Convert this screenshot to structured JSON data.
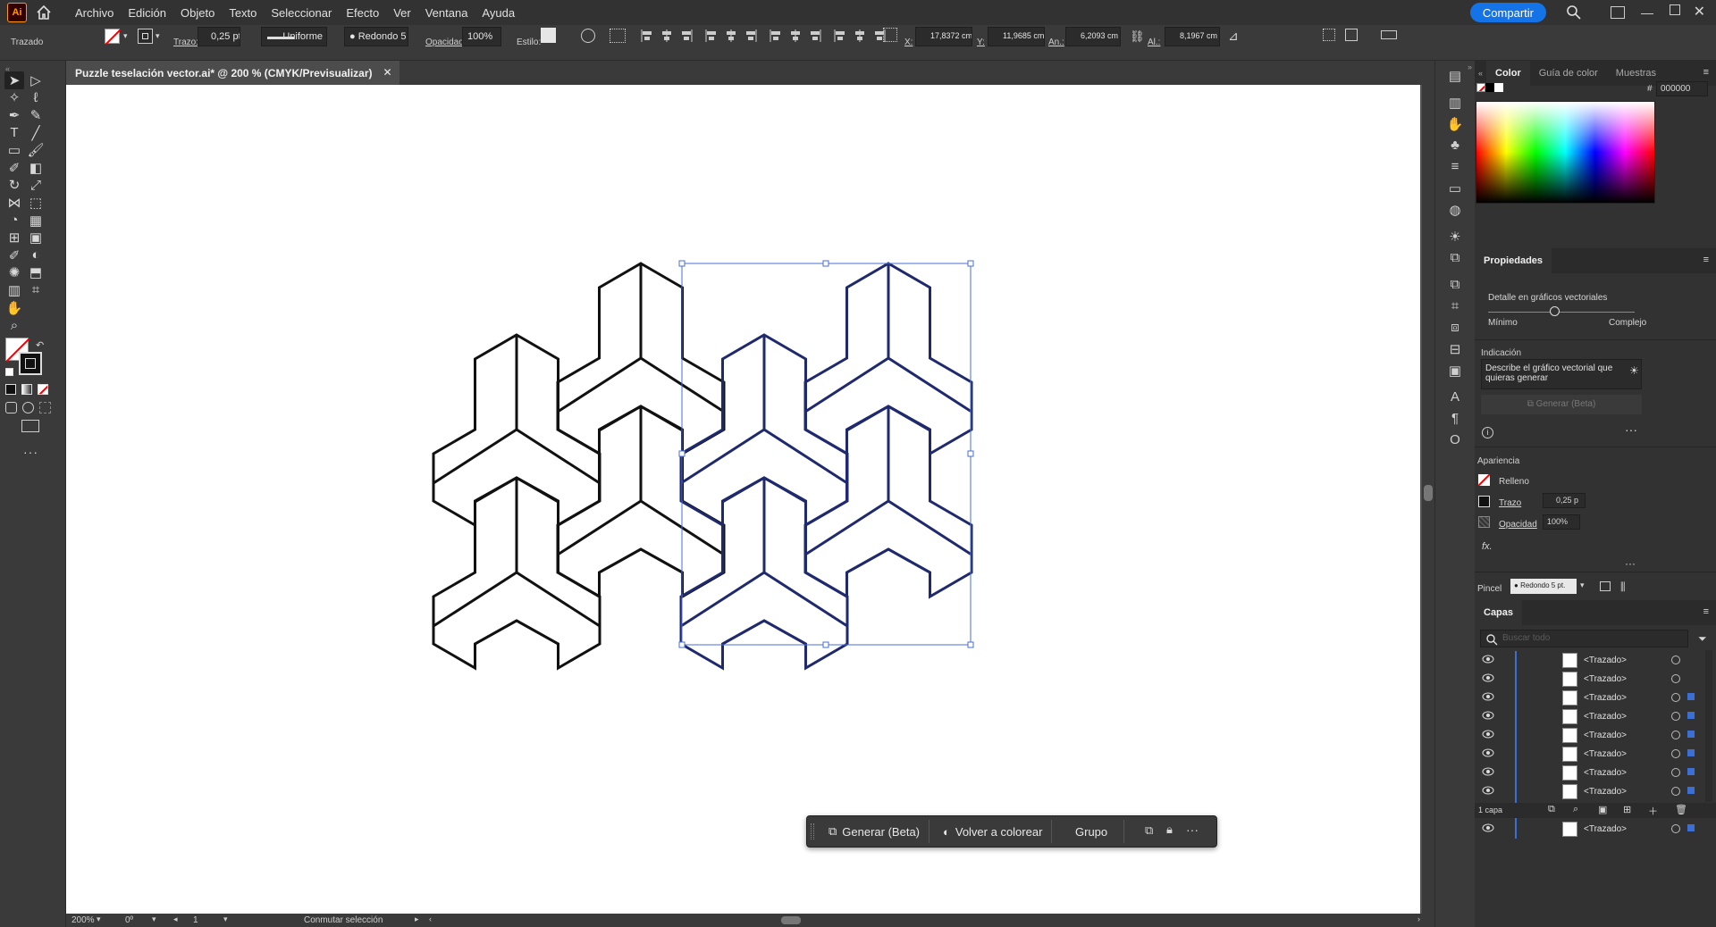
{
  "app": {
    "logo": "Ai"
  },
  "menu": [
    "Archivo",
    "Edición",
    "Objeto",
    "Texto",
    "Seleccionar",
    "Efecto",
    "Ver",
    "Ventana",
    "Ayuda"
  ],
  "share_label": "Compartir",
  "control": {
    "object_type": "Trazado",
    "stroke_label": "Trazo:",
    "stroke_value": "0,25 pt",
    "profile": "Uniforme",
    "brush": "Redondo 5 ...",
    "opacity_label": "Opacidad:",
    "opacity_value": "100%",
    "style_label": "Estilo:",
    "x_label": "X:",
    "x_value": "17,8372 cm",
    "y_label": "Y:",
    "y_value": "11,9685 cm",
    "w_label": "An.:",
    "w_value": "6,2093 cm",
    "h_label": "Al.:",
    "h_value": "8,1967 cm"
  },
  "doc_tab": "Puzzle teselación vector.ai* @ 200 % (CMYK/Previsualizar)",
  "status": {
    "zoom": "200%",
    "angle": "0º",
    "artboard": "1",
    "tool_hint": "Conmutar selección"
  },
  "context_bar": {
    "generate": "Generar (Beta)",
    "recolor": "Volver a colorear",
    "group": "Grupo"
  },
  "color_panel": {
    "tabs": [
      "Color",
      "Guía de color",
      "Muestras"
    ],
    "hex": "000000"
  },
  "properties": {
    "title": "Propiedades",
    "detail_label": "Detalle en gráficos vectoriales",
    "min_label": "Mínimo",
    "max_label": "Complejo",
    "slider_level": 0.45,
    "prompt_label": "Indicación",
    "prompt_placeholder": "Describe el gráfico vectorial que quieras generar",
    "generate_label": "Generar (Beta)",
    "appearance_label": "Apariencia",
    "fill_label": "Relleno",
    "stroke_label": "Trazo",
    "stroke_value": "0,25 p",
    "opacity_label": "Opacidad",
    "opacity_value": "100%",
    "fx_label": "fx.",
    "brush_label": "Pincel",
    "brush_value": "Redondo 5 pt."
  },
  "layers": {
    "title": "Capas",
    "search_placeholder": "Buscar todo",
    "rows": [
      "<Trazado>",
      "<Trazado>",
      "<Trazado>",
      "<Trazado>",
      "<Trazado>",
      "<Trazado>",
      "<Trazado>",
      "<Trazado>",
      "<Trazado>",
      "<Trazado>"
    ],
    "footer": "1 capa"
  },
  "colors": {
    "accent": "#1473e6",
    "selection": "#3b5bd9",
    "artboard": "#ffffff"
  }
}
